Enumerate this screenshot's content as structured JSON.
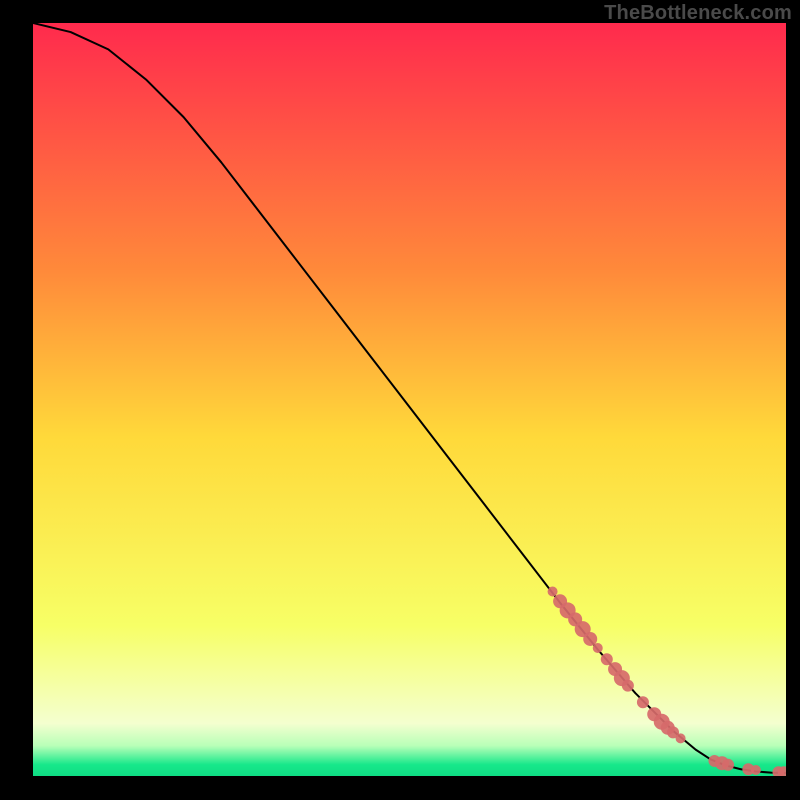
{
  "watermark": "TheBottleneck.com",
  "colors": {
    "marker": "#d66a6a",
    "curve": "#000000",
    "frame": "#000000",
    "grad_top": "#ff2a4d",
    "grad_mid_upper": "#ff8a3a",
    "grad_mid": "#ffd93a",
    "grad_lower": "#f7ff66",
    "grad_green_top": "#b8ffb8",
    "grad_green": "#17e88a"
  },
  "chart_data": {
    "type": "line",
    "title": "",
    "xlabel": "",
    "ylabel": "",
    "xlim": [
      0,
      100
    ],
    "ylim": [
      0,
      100
    ],
    "series": [
      {
        "name": "curve",
        "x": [
          0,
          5,
          10,
          15,
          20,
          25,
          30,
          35,
          40,
          45,
          50,
          55,
          60,
          65,
          70,
          75,
          80,
          85,
          88,
          90,
          92,
          94,
          96,
          98,
          100
        ],
        "y": [
          100,
          98.8,
          96.5,
          92.5,
          87.5,
          81.5,
          75.0,
          68.5,
          62.0,
          55.5,
          49.0,
          42.5,
          36.0,
          29.5,
          23.0,
          16.8,
          11.0,
          6.0,
          3.5,
          2.2,
          1.4,
          0.9,
          0.6,
          0.45,
          0.4
        ]
      }
    ],
    "scatter": [
      {
        "x": 69.0,
        "y": 24.5,
        "r": 5
      },
      {
        "x": 70.0,
        "y": 23.2,
        "r": 7
      },
      {
        "x": 71.0,
        "y": 22.0,
        "r": 8
      },
      {
        "x": 72.0,
        "y": 20.8,
        "r": 7
      },
      {
        "x": 73.0,
        "y": 19.5,
        "r": 8
      },
      {
        "x": 74.0,
        "y": 18.2,
        "r": 7
      },
      {
        "x": 75.0,
        "y": 17.0,
        "r": 5
      },
      {
        "x": 76.2,
        "y": 15.5,
        "r": 6
      },
      {
        "x": 77.3,
        "y": 14.2,
        "r": 7
      },
      {
        "x": 78.2,
        "y": 13.0,
        "r": 8
      },
      {
        "x": 79.0,
        "y": 12.0,
        "r": 6
      },
      {
        "x": 81.0,
        "y": 9.8,
        "r": 6
      },
      {
        "x": 82.5,
        "y": 8.2,
        "r": 7
      },
      {
        "x": 83.5,
        "y": 7.2,
        "r": 8
      },
      {
        "x": 84.3,
        "y": 6.4,
        "r": 7
      },
      {
        "x": 85.0,
        "y": 5.8,
        "r": 6
      },
      {
        "x": 86.0,
        "y": 5.0,
        "r": 5
      },
      {
        "x": 90.5,
        "y": 2.0,
        "r": 6
      },
      {
        "x": 91.5,
        "y": 1.7,
        "r": 7
      },
      {
        "x": 92.3,
        "y": 1.5,
        "r": 6
      },
      {
        "x": 95.0,
        "y": 0.9,
        "r": 6
      },
      {
        "x": 96.0,
        "y": 0.8,
        "r": 5
      },
      {
        "x": 99.0,
        "y": 0.5,
        "r": 6
      },
      {
        "x": 99.7,
        "y": 0.5,
        "r": 6
      }
    ]
  }
}
